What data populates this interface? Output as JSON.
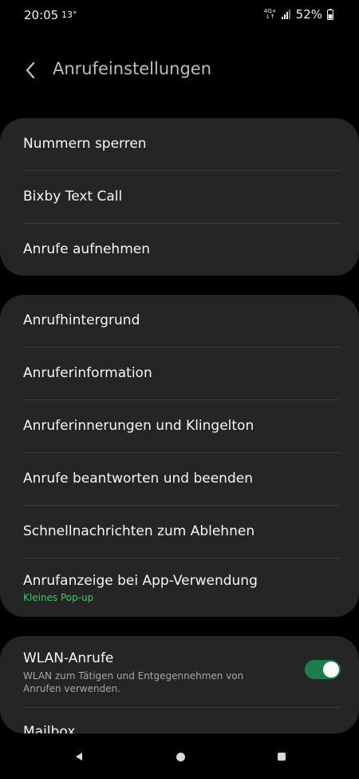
{
  "status_bar": {
    "time": "20:05",
    "temperature": "13°",
    "network": "4G+",
    "battery": "52%"
  },
  "header": {
    "title": "Anrufeinstellungen"
  },
  "groups": [
    {
      "items": [
        {
          "label": "Nummern sperren"
        },
        {
          "label": "Bixby Text Call"
        },
        {
          "label": "Anrufe aufnehmen"
        }
      ]
    },
    {
      "items": [
        {
          "label": "Anrufhintergrund"
        },
        {
          "label": "Anruferinformation"
        },
        {
          "label": "Anruferinnerungen und Klingelton"
        },
        {
          "label": "Anrufe beantworten und beenden"
        },
        {
          "label": "Schnellnachrichten zum Ablehnen"
        },
        {
          "label": "Anrufanzeige bei App-Verwendung",
          "sublabel": "Kleines Pop-up"
        }
      ]
    },
    {
      "items": [
        {
          "label": "WLAN-Anrufe",
          "description": "WLAN zum Tätigen und Entgegennehmen von Anrufen verwenden.",
          "toggle_on": true
        },
        {
          "label": "Mailbox"
        }
      ]
    }
  ],
  "colors": {
    "background": "#000000",
    "card": "#252525",
    "accent_green": "#3ec46d",
    "toggle_track": "#1f7a4c"
  },
  "icons": {
    "back": "chevron-left-icon",
    "signal": "signal-bars-icon",
    "battery": "battery-icon",
    "nav_back": "nav-back-icon",
    "nav_home": "nav-home-icon",
    "nav_recent": "nav-recent-icon"
  }
}
